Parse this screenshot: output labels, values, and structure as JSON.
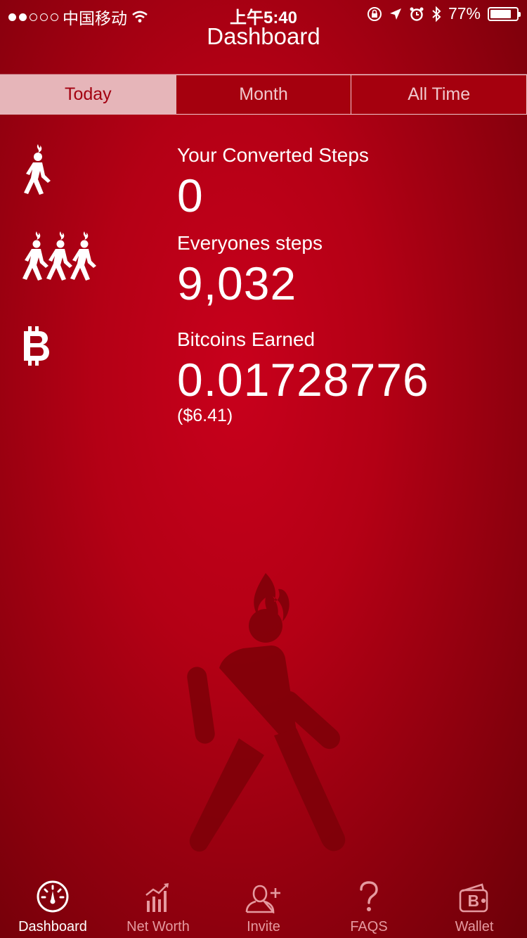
{
  "status_bar": {
    "carrier": "中国移动",
    "time": "上午5:40",
    "battery": "77%",
    "battery_level": 0.77
  },
  "nav": {
    "title": "Dashboard"
  },
  "segments": [
    {
      "label": "Today",
      "active": true
    },
    {
      "label": "Month",
      "active": false
    },
    {
      "label": "All Time",
      "active": false
    }
  ],
  "stats": {
    "converted_steps": {
      "label": "Your Converted Steps",
      "value": "0"
    },
    "everyone_steps": {
      "label": "Everyones steps",
      "value": "9,032"
    },
    "bitcoins": {
      "label": "Bitcoins Earned",
      "value": "0.01728776",
      "usd": "($6.41)"
    }
  },
  "tabs": [
    {
      "label": "Dashboard",
      "icon": "gauge-icon",
      "active": true
    },
    {
      "label": "Net Worth",
      "icon": "chart-icon",
      "active": false
    },
    {
      "label": "Invite",
      "icon": "add-person-icon",
      "active": false
    },
    {
      "label": "FAQS",
      "icon": "question-icon",
      "active": false
    },
    {
      "label": "Wallet",
      "icon": "wallet-icon",
      "active": false
    }
  ],
  "colors": {
    "background": "#b40015",
    "segment_active": "#e6b5b9",
    "tab_inactive": "#e59aa0"
  }
}
